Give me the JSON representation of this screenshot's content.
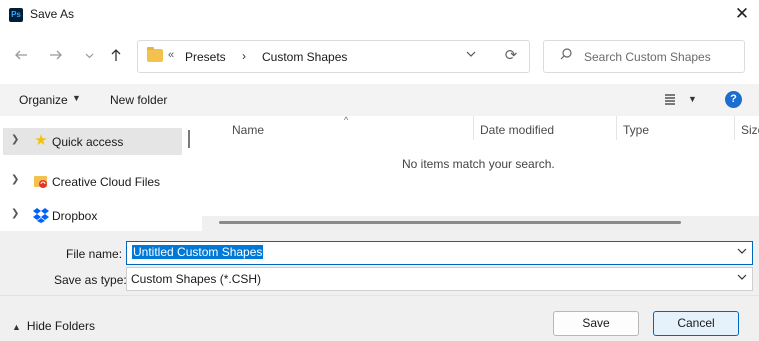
{
  "window": {
    "title": "Save As",
    "app_icon": "photoshop-icon",
    "app_icon_text": "Ps"
  },
  "navigation": {
    "back_icon": "arrow-left-icon",
    "forward_icon": "arrow-right-icon",
    "recent_icon": "chevron-down-icon",
    "up_icon": "arrow-up-icon"
  },
  "address": {
    "overflow": "«",
    "crumbs": [
      "Presets",
      "Custom Shapes"
    ],
    "separator": "›"
  },
  "search": {
    "placeholder": "Search Custom Shapes"
  },
  "toolbar": {
    "organize_label": "Organize",
    "new_folder_label": "New folder",
    "help_label": "?"
  },
  "sidebar": {
    "items": [
      {
        "label": "Quick access",
        "icon": "star-icon",
        "selected": true
      },
      {
        "label": "Creative Cloud Files",
        "icon": "creative-cloud-folder-icon"
      },
      {
        "label": "Dropbox",
        "icon": "dropbox-icon"
      }
    ]
  },
  "file_list": {
    "columns": [
      "Name",
      "Date modified",
      "Type",
      "Size"
    ],
    "empty_message": "No items match your search."
  },
  "form": {
    "file_name_label": "File name:",
    "file_name_value": "Untitled Custom Shapes",
    "save_type_label": "Save as type:",
    "save_type_value": "Custom Shapes (*.CSH)"
  },
  "footer": {
    "hide_folders_label": "Hide Folders",
    "save_label": "Save",
    "cancel_label": "Cancel"
  },
  "colors": {
    "accent": "#0078d7",
    "help_badge": "#1c6dd0",
    "folder": "#f2c14e",
    "star": "#f4c20d",
    "dropbox": "#0061fe",
    "creative_cloud": "#e8322b"
  }
}
